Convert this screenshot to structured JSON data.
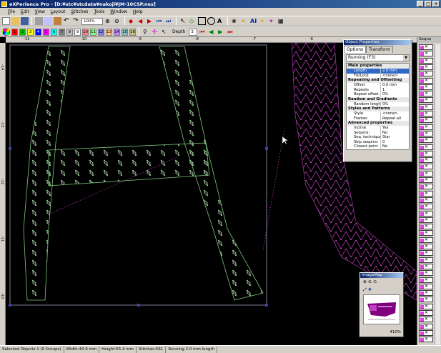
{
  "window": {
    "title": "eXPerience Pro - [D:¥stc¥stcdata¥nakoji¥JM-10CSP.nes]"
  },
  "menu": [
    "File",
    "Edit",
    "View",
    "Layout",
    "Stitches",
    "Tools",
    "Window",
    "Help"
  ],
  "toolbar": {
    "zoom": "100%",
    "depth_label": "Depth",
    "depth_value": "3"
  },
  "palette": [
    "1",
    "2",
    "3",
    "4",
    "5",
    "6",
    "7",
    "8",
    "9",
    "10",
    "11",
    "12",
    "13",
    "14",
    "15",
    "16"
  ],
  "props": {
    "title": "Object Properties",
    "tabs": [
      "Options",
      "Transform"
    ],
    "combo": "Running (F3)",
    "sections": [
      {
        "name": "Main properties",
        "rows": [
          {
            "k": "Length",
            "v": "2.0 mm",
            "sel": true
          },
          {
            "k": "Fix/Lock",
            "v": "<none>"
          }
        ]
      },
      {
        "name": "Repeating and Offsetting",
        "rows": [
          {
            "k": "Offset",
            "v": "0.0 mm"
          },
          {
            "k": "Repeats",
            "v": "1"
          },
          {
            "k": "Repeat offset",
            "v": "0%"
          }
        ]
      },
      {
        "name": "Random and Gradients",
        "rows": [
          {
            "k": "Random length",
            "v": "0%"
          }
        ]
      },
      {
        "name": "Styles and Patterns",
        "rows": [
          {
            "k": "Style",
            "v": "<none>"
          },
          {
            "k": "Frames",
            "v": "Repeat all"
          }
        ]
      },
      {
        "name": "Advanced properties",
        "rows": [
          {
            "k": "Incline",
            "v": "Yes"
          },
          {
            "k": "Sequins:",
            "v": "No"
          },
          {
            "k": "Seq. technique:",
            "v": "Star"
          },
          {
            "k": "Skip sequins:",
            "v": "0"
          },
          {
            "k": "Closest point",
            "v": "No"
          }
        ]
      }
    ]
  },
  "sequence": {
    "title": "Seque"
  },
  "imagemap": {
    "title": "ImageMap",
    "zoom": "410%"
  },
  "status": {
    "selected": "Selected Objects:1 (0 Groups)",
    "width": "Width:44.9 mm",
    "height": "Height:55.4 mm",
    "stitches": "Stitches:561",
    "mode": "Running 2.0 mm length"
  },
  "colors": {
    "green": "#7ec87e",
    "magenta": "#c040c0",
    "canvas": "#000000"
  }
}
